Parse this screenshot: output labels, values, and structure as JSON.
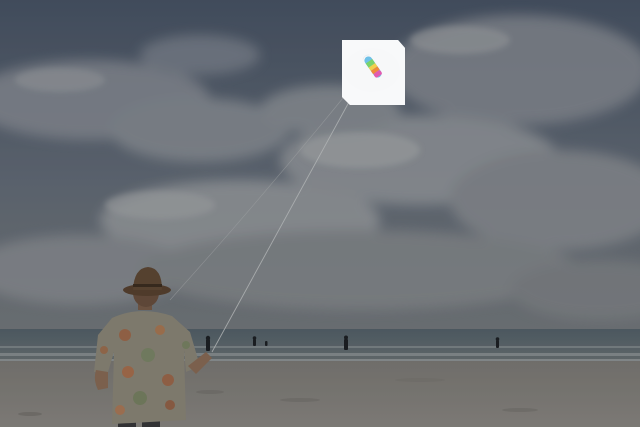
{
  "image": {
    "kind": "photo",
    "subject": "beach-kite-flying",
    "colors": {
      "sky_top": "#4f5c6e",
      "sky_mid": "#6b7787",
      "cloud": "#9aa0a6",
      "cloud_light": "#b6b9bb",
      "sea": "#5d6a72",
      "surf": "#9ea4a6",
      "sand": "#8c8a86",
      "sand_dark": "#6e6c68",
      "highlight_box": "#ffffff",
      "kite_colors": [
        "#6fc1e8",
        "#7ad36b",
        "#f2d04a",
        "#f08a3a",
        "#e25bb0"
      ]
    }
  }
}
